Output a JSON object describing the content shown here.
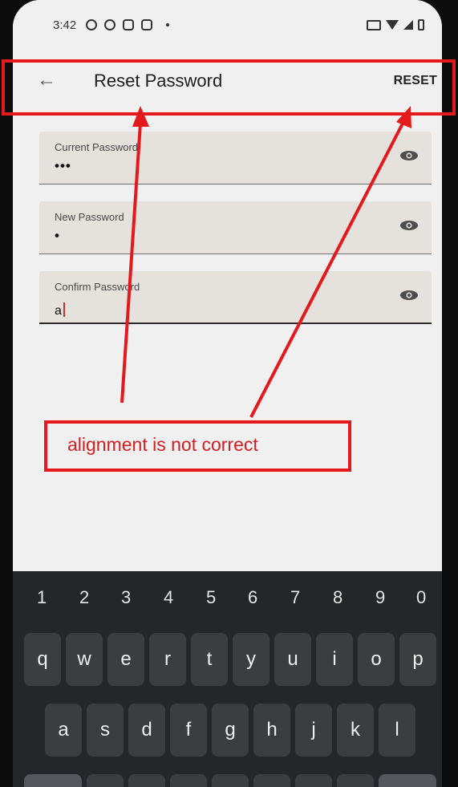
{
  "status_bar": {
    "time": "3:42",
    "left_icons": [
      "whatsapp-icon",
      "chat-icon",
      "instagram-icon",
      "instagram-icon",
      "dot-icon"
    ],
    "right_icons": [
      "cast-icon",
      "wifi-icon",
      "signal-icon",
      "battery-icon"
    ]
  },
  "appbar": {
    "title": "Reset Password",
    "action_label": "RESET"
  },
  "form": {
    "fields": [
      {
        "label": "Current Password",
        "value": "•••"
      },
      {
        "label": "New Password",
        "value": "•"
      },
      {
        "label": "Confirm Password",
        "value": "a"
      }
    ]
  },
  "keyboard": {
    "numbers": [
      "1",
      "2",
      "3",
      "4",
      "5",
      "6",
      "7",
      "8",
      "9",
      "0"
    ],
    "row1": [
      "q",
      "w",
      "e",
      "r",
      "t",
      "y",
      "u",
      "i",
      "o",
      "p"
    ],
    "row2": [
      "a",
      "s",
      "d",
      "f",
      "g",
      "h",
      "j",
      "k",
      "l"
    ]
  },
  "annotation": {
    "text": "alignment is not correct",
    "color": "#e3191b"
  }
}
